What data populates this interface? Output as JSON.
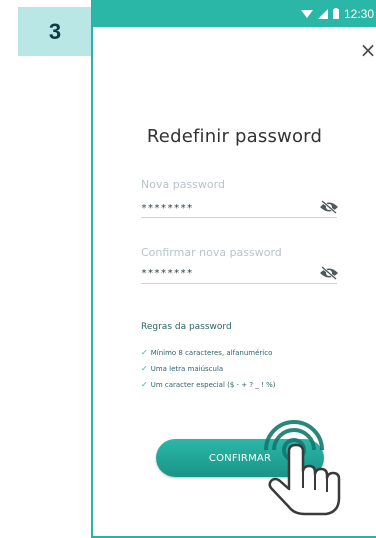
{
  "step": "3",
  "status_bar": {
    "time": "12:30"
  },
  "screen": {
    "title": "Redefinir password",
    "new_password": {
      "label": "Nova password",
      "value": "********"
    },
    "confirm_password": {
      "label": "Confirmar nova password",
      "value": "********"
    },
    "rules": {
      "title": "Regras da password",
      "items": [
        "Mínimo 8 caracteres, alfanumérico",
        "Uma letra maiúscula",
        "Um caracter especial ($ - + ? _ ! %)"
      ]
    },
    "confirm_label": "CONFIRMAR"
  },
  "colors": {
    "accent": "#2bb7a8",
    "badge_bg": "#b9e7e6"
  }
}
